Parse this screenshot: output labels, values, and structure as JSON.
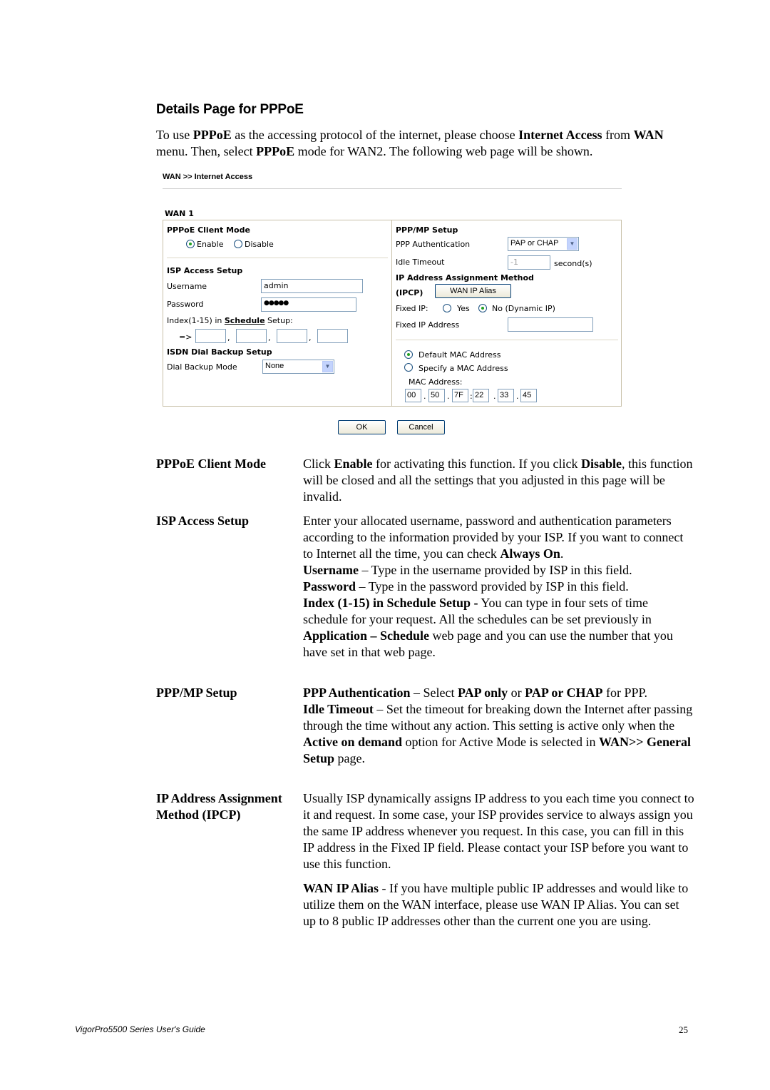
{
  "heading": "Details Page for PPPoE",
  "intro": {
    "parts": [
      {
        "t": "To use ",
        "b": false
      },
      {
        "t": "PPPoE",
        "b": true
      },
      {
        "t": " as the accessing protocol of the internet, please choose ",
        "b": false
      },
      {
        "t": "Internet Access",
        "b": true
      },
      {
        "t": " from ",
        "b": false
      },
      {
        "t": "WAN",
        "b": true
      },
      {
        "t": " menu. Then, select ",
        "b": false
      },
      {
        "t": "PPPoE",
        "b": true
      },
      {
        "t": " mode for WAN2. The following web page will be shown.",
        "b": false
      }
    ]
  },
  "ui": {
    "breadcrumb": "WAN >> Internet Access",
    "wan_label": "WAN 1",
    "pppoe_client_mode": {
      "title": "PPPoE Client Mode",
      "enable_label": "Enable",
      "disable_label": "Disable",
      "selected": "Enable"
    },
    "isp_access": {
      "title": "ISP Access Setup",
      "username_label": "Username",
      "username_value": "admin",
      "password_label": "Password",
      "password_value": "●●●●●",
      "index_prefix": "Index(1-15) in",
      "schedule_link": "Schedule",
      "index_suffix": "Setup:",
      "arrow": "=>",
      "schedule_values": [
        "",
        "",
        "",
        ""
      ],
      "separator": ","
    },
    "isdn": {
      "title": "ISDN Dial Backup Setup",
      "mode_label": "Dial Backup Mode",
      "mode_value": "None"
    },
    "ppp_mp": {
      "title": "PPP/MP Setup",
      "auth_label": "PPP Authentication",
      "auth_value": "PAP or CHAP",
      "idle_label": "Idle Timeout",
      "idle_value": "-1",
      "idle_unit": "second(s)"
    },
    "ipcp": {
      "title": "IP Address Assignment Method",
      "title2": "(IPCP)",
      "alias_button": "WAN IP Alias",
      "fixed_ip_label": "Fixed IP:",
      "yes_label": "Yes",
      "no_label": "No (Dynamic IP)",
      "selected": "No",
      "fixed_addr_label": "Fixed IP Address",
      "fixed_addr_value": ""
    },
    "mac": {
      "default_label": "Default MAC Address",
      "specify_label": "Specify a MAC Address",
      "selected": "Default",
      "address_label": "MAC Address:",
      "octets": [
        "00",
        "50",
        "7F",
        "22",
        "33",
        "45"
      ],
      "separators": [
        ".",
        ".",
        ":",
        ".",
        "."
      ]
    },
    "ok_button": "OK",
    "cancel_button": "Cancel"
  },
  "descriptions": [
    {
      "term": "PPPoE Client Mode",
      "paragraphs": [
        [
          {
            "t": "Click ",
            "b": false
          },
          {
            "t": "Enable",
            "b": true
          },
          {
            "t": " for activating this function. If you click ",
            "b": false
          },
          {
            "t": "Disable",
            "b": true
          },
          {
            "t": ", this function will be closed and all the settings that you adjusted in this page will be invalid.",
            "b": false
          }
        ]
      ]
    },
    {
      "term": "ISP Access Setup",
      "paragraphs": [
        [
          {
            "t": "Enter your allocated username, password and authentication parameters according to the information provided by your ISP. If you want to connect to Internet all the time, you can check ",
            "b": false
          },
          {
            "t": "Always On",
            "b": true
          },
          {
            "t": ".",
            "b": false
          }
        ],
        [
          {
            "t": "Username",
            "b": true
          },
          {
            "t": " – Type in the username provided by ISP in this field.",
            "b": false
          }
        ],
        [
          {
            "t": "Password",
            "b": true
          },
          {
            "t": " – Type in the password provided by ISP in this field.",
            "b": false
          }
        ],
        [
          {
            "t": "Index (1-15) in Schedule Setup -",
            "b": true
          },
          {
            "t": " You can type in four sets of time schedule for your request. All the schedules can be set previously in ",
            "b": false
          },
          {
            "t": "Application – Schedule",
            "b": true
          },
          {
            "t": " web page and you can use the number that you have set in that web page.",
            "b": false
          }
        ]
      ]
    },
    {
      "term": "PPP/MP Setup",
      "paragraphs": [
        [
          {
            "t": "PPP Authentication",
            "b": true
          },
          {
            "t": " – Select ",
            "b": false
          },
          {
            "t": "PAP only",
            "b": true
          },
          {
            "t": " or ",
            "b": false
          },
          {
            "t": "PAP or CHAP",
            "b": true
          },
          {
            "t": " for PPP.",
            "b": false
          }
        ],
        [
          {
            "t": "Idle Timeout",
            "b": true
          },
          {
            "t": " – Set the timeout for breaking down the Internet after passing through the time without any action. This setting is active only when the ",
            "b": false
          },
          {
            "t": "Active on demand",
            "b": true
          },
          {
            "t": " option for Active Mode is selected in ",
            "b": false
          },
          {
            "t": "WAN>> General Setup",
            "b": true
          },
          {
            "t": " page.",
            "b": false
          }
        ]
      ]
    },
    {
      "term": "IP Address Assignment Method (IPCP)",
      "paragraphs": [
        [
          {
            "t": "Usually ISP dynamically assigns IP address to you each time you connect to it and request. In some case, your ISP provides service to always assign you the same IP address whenever you request. In this case, you can fill in this IP address in the Fixed IP field. Please contact your ISP before you want to use this function.",
            "b": false
          }
        ],
        [
          {
            "t": "WAN IP Alias",
            "b": true
          },
          {
            "t": " - If you have multiple public IP addresses and would like to utilize them on the WAN interface, please use WAN IP Alias. You can set up to 8 public IP addresses other than the current one you are using.",
            "b": false
          }
        ]
      ]
    }
  ],
  "footer": {
    "guide": "VigorPro5500 Series User's Guide",
    "page": "25"
  }
}
